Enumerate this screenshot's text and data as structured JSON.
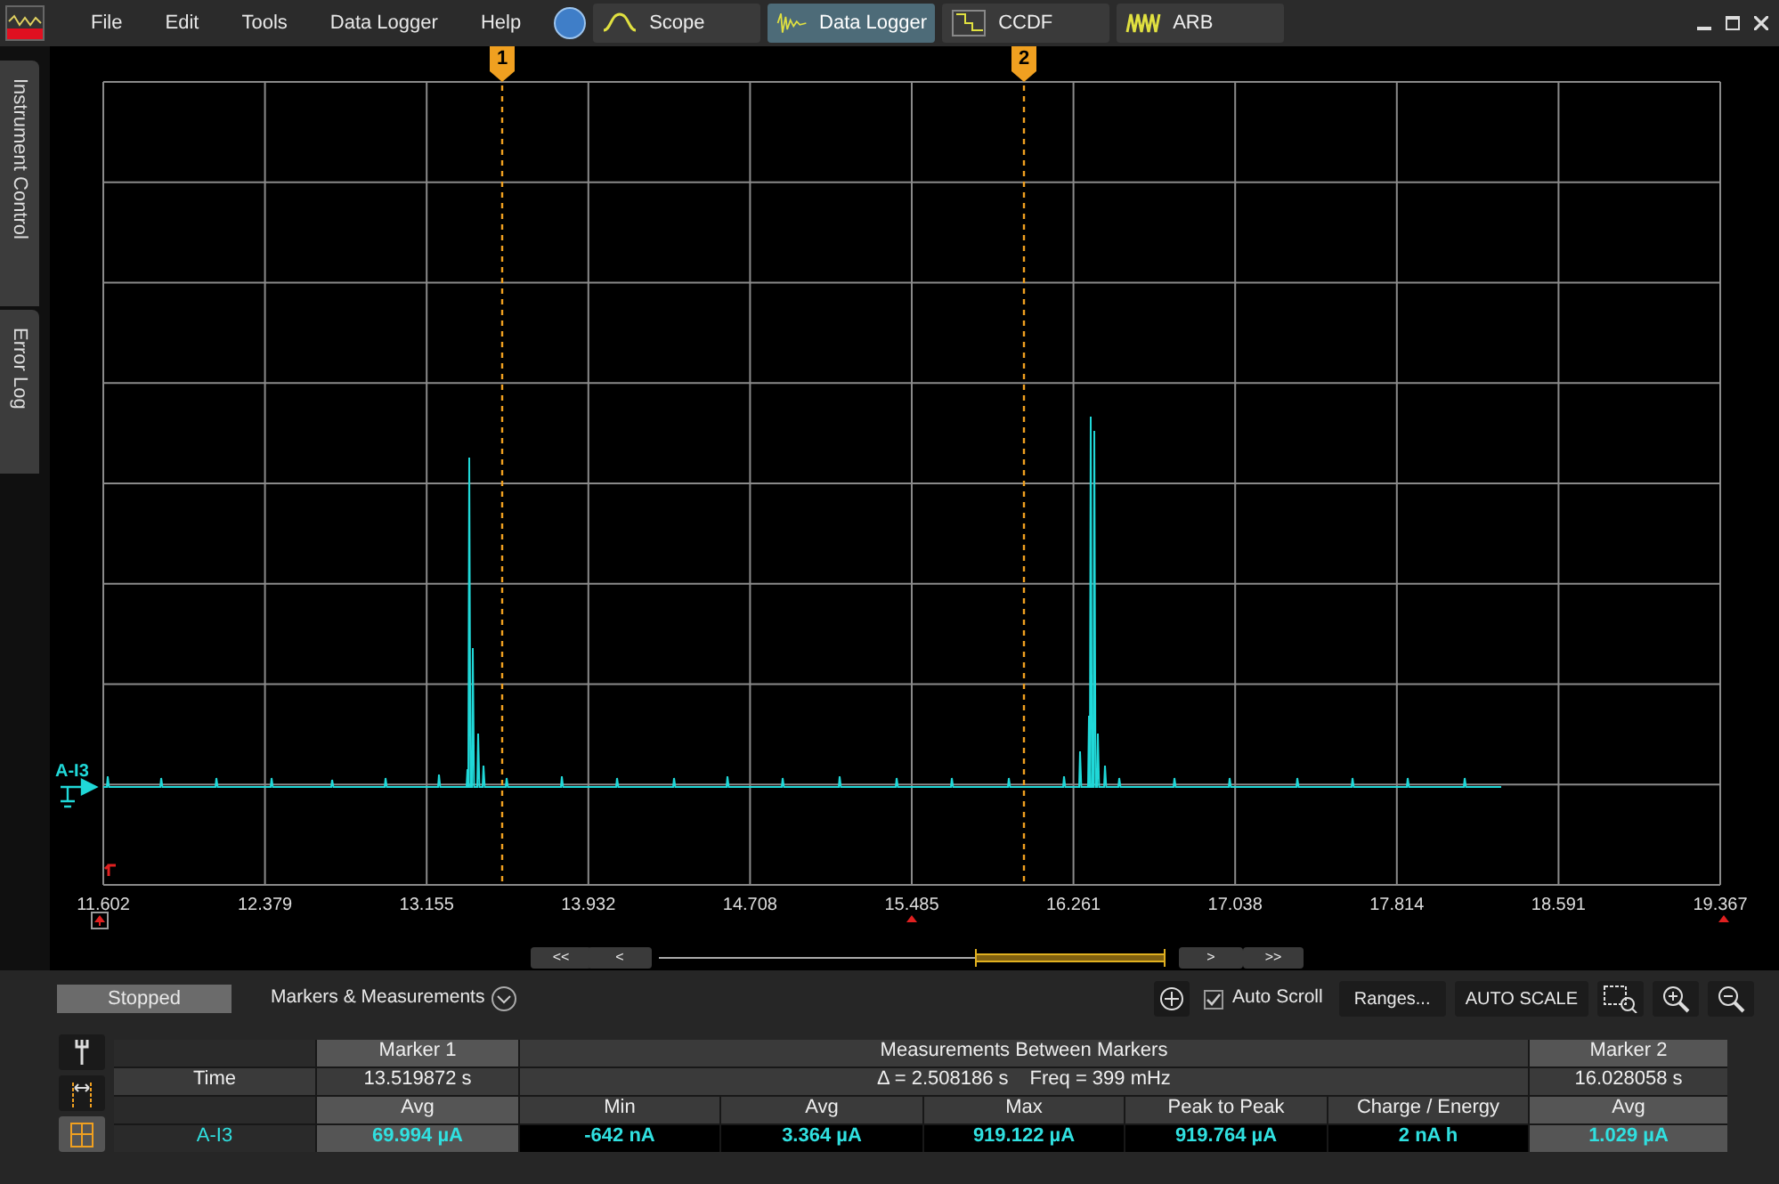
{
  "menu": [
    "File",
    "Edit",
    "Tools",
    "Data Logger",
    "Help"
  ],
  "tabs": [
    {
      "label": "Scope",
      "kind": "scope",
      "selected": false
    },
    {
      "label": "Data Logger",
      "kind": "logger",
      "selected": true
    },
    {
      "label": "CCDF",
      "kind": "ccdf",
      "selected": false
    },
    {
      "label": "ARB",
      "kind": "arb",
      "selected": false
    }
  ],
  "side_tabs": [
    "Instrument Control",
    "Error Log"
  ],
  "plot": {
    "channel": "A-I3",
    "x_ticks": [
      "11.602",
      "12.379",
      "13.155",
      "13.932",
      "14.708",
      "15.485",
      "16.261",
      "17.038",
      "17.814",
      "18.591",
      "19.367"
    ],
    "markers": [
      "1",
      "2"
    ]
  },
  "scroll_buttons": [
    "<<",
    "<",
    ">",
    ">>"
  ],
  "controls": {
    "status": "Stopped",
    "section": "Markers & Measurements",
    "auto_scroll": {
      "label": "Auto Scroll",
      "checked": true
    },
    "buttons": [
      "Ranges...",
      "AUTO SCALE"
    ]
  },
  "table": {
    "marker_1": "Marker 1",
    "between": "Measurements Between Markers",
    "marker_2": "Marker 2",
    "time_label": "Time",
    "time_1": "13.519872 s",
    "delta": "Δ = 2.508186 s",
    "freq": "Freq = 399 mHz",
    "time_2": "16.028058 s",
    "stats": [
      "Avg",
      "Min",
      "Avg",
      "Max",
      "Peak to Peak",
      "Charge / Energy",
      "Avg"
    ],
    "channel": "A-I3",
    "values": [
      "69.994 µA",
      "-642 nA",
      "3.364 µA",
      "919.122 µA",
      "919.764 µA",
      "2 nA h",
      "1.029 µA"
    ]
  }
}
